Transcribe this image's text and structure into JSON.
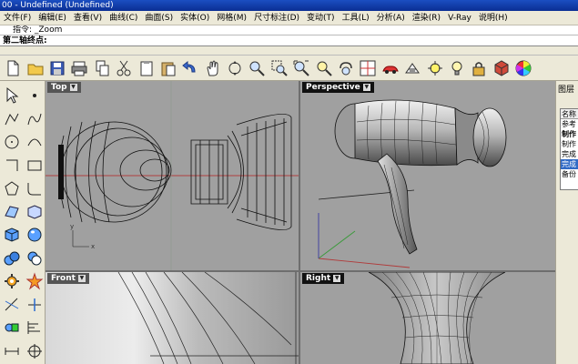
{
  "window": {
    "title": "00 - Undefined (Undefined)"
  },
  "menu": [
    {
      "label": "文件(F)"
    },
    {
      "label": "编辑(E)"
    },
    {
      "label": "查看(V)"
    },
    {
      "label": "曲线(C)"
    },
    {
      "label": "曲面(S)"
    },
    {
      "label": "实体(O)"
    },
    {
      "label": "网格(M)"
    },
    {
      "label": "尺寸标注(D)"
    },
    {
      "label": "变动(T)"
    },
    {
      "label": "工具(L)"
    },
    {
      "label": "分析(A)"
    },
    {
      "label": "渲染(R)"
    },
    {
      "label": "V-Ray"
    },
    {
      "label": "说明(H)"
    }
  ],
  "command": {
    "history": "指令: _Zoom",
    "prompt": "第二轴终点:"
  },
  "toolbar": [
    {
      "icon": "new-file-icon"
    },
    {
      "icon": "open-folder-icon"
    },
    {
      "icon": "save-icon"
    },
    {
      "icon": "print-icon"
    },
    {
      "icon": "copy-icon"
    },
    {
      "icon": "cut-icon"
    },
    {
      "icon": "copy-clipboard-icon"
    },
    {
      "icon": "paste-icon"
    },
    {
      "icon": "undo-icon"
    },
    {
      "icon": "pan-hand-icon"
    },
    {
      "icon": "rotate-view-icon"
    },
    {
      "icon": "zoom-dynamic-icon"
    },
    {
      "icon": "zoom-window-icon"
    },
    {
      "icon": "zoom-extents-icon"
    },
    {
      "icon": "zoom-selected-icon"
    },
    {
      "icon": "undo-view-icon"
    },
    {
      "icon": "four-viewports-icon"
    },
    {
      "icon": "car-icon"
    },
    {
      "icon": "grid-icon"
    },
    {
      "icon": "osnap-icon"
    },
    {
      "icon": "light-bulb-icon"
    },
    {
      "icon": "lock-icon"
    },
    {
      "icon": "material-icon"
    },
    {
      "icon": "color-wheel-icon"
    }
  ],
  "lefttools": [
    {
      "icon": "select-arrow-icon"
    },
    {
      "icon": "point-icon"
    },
    {
      "icon": "polyline-icon"
    },
    {
      "icon": "curve-icon"
    },
    {
      "icon": "circle-icon"
    },
    {
      "icon": "arc-icon"
    },
    {
      "icon": "rectangle-polyline-icon"
    },
    {
      "icon": "rectangle-icon"
    },
    {
      "icon": "polygon-icon"
    },
    {
      "icon": "fillet-curve-icon"
    },
    {
      "icon": "surface-icon"
    },
    {
      "icon": "extrude-surface-icon"
    },
    {
      "icon": "box-icon"
    },
    {
      "icon": "sphere-icon"
    },
    {
      "icon": "mesh-icon"
    },
    {
      "icon": "boolean-icon"
    },
    {
      "icon": "gear-transform-icon"
    },
    {
      "icon": "explode-icon"
    },
    {
      "icon": "trim-icon"
    },
    {
      "icon": "split-icon"
    },
    {
      "icon": "group-icon"
    },
    {
      "icon": "align-icon"
    },
    {
      "icon": "dimension-icon"
    },
    {
      "icon": "snap-icon"
    }
  ],
  "viewports": {
    "top": {
      "label": "Top"
    },
    "perspective": {
      "label": "Perspective"
    },
    "front": {
      "label": "Front"
    },
    "right": {
      "label": "Right"
    }
  },
  "panel": {
    "title": "图层",
    "layers": [
      {
        "name": "名称",
        "head": true
      },
      {
        "name": "参考"
      },
      {
        "name": "制作",
        "bold": true
      },
      {
        "name": "制作"
      },
      {
        "name": "完成"
      },
      {
        "name": "完成",
        "selected": true
      },
      {
        "name": "备份"
      }
    ]
  },
  "colors": {
    "title_bar": "#0a2e93",
    "viewport_bg": "#a0a0a0",
    "active_viewport_label": "#111111",
    "x_axis": "#c03030",
    "y_axis": "#30a030",
    "selected_layer": "#316ac5"
  }
}
